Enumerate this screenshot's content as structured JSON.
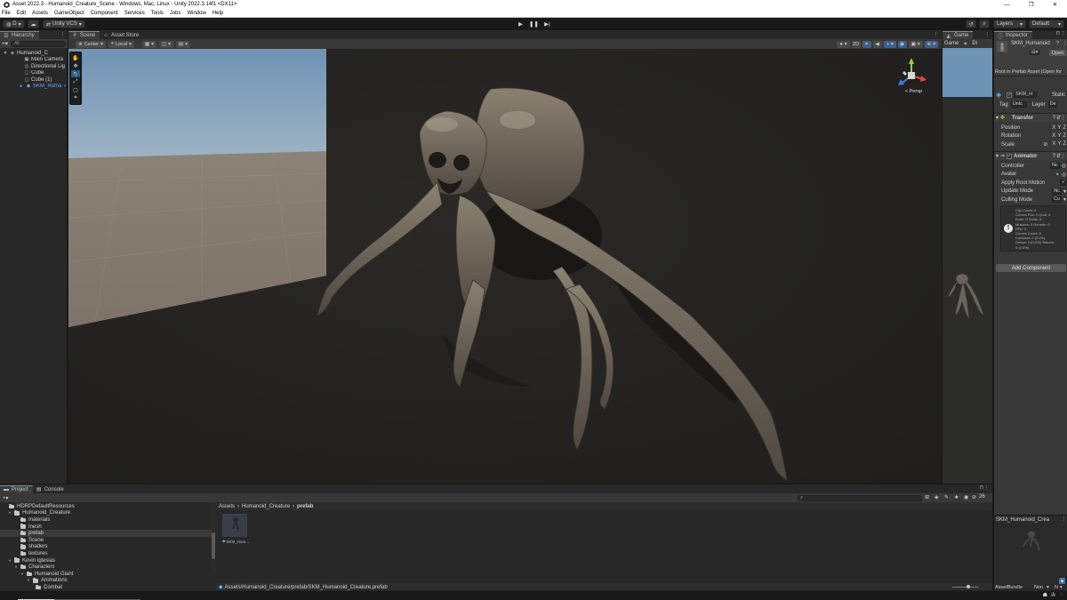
{
  "window": {
    "title": "Asset 2022.3 - Humanoid_Creature_Scene - Windows, Mac, Linux - Unity 2022.3.14f1 <DX11>",
    "controls": [
      "—",
      "❐",
      "✕"
    ]
  },
  "menu": [
    "File",
    "Edit",
    "Assets",
    "GameObject",
    "Component",
    "Services",
    "Tools",
    "Jobs",
    "Window",
    "Help"
  ],
  "toolbar": {
    "account_label": "D",
    "vcs_label": "Unity VCS",
    "layers_label": "Layers",
    "layout_label": "Default"
  },
  "hierarchy": {
    "tab_label": "Hierarchy",
    "search_placeholder": "All",
    "rows": [
      {
        "label": "Humanoid_C",
        "icon": "unity-scene-icon"
      },
      {
        "label": "Main Camera",
        "icon": "camera-icon"
      },
      {
        "label": "Directional Lig",
        "icon": "light-icon"
      },
      {
        "label": "Cube",
        "icon": "cube-icon"
      },
      {
        "label": "Cube (1)",
        "icon": "cube-icon"
      },
      {
        "label": "SKM_Huma",
        "icon": "prefab-icon"
      }
    ]
  },
  "scene": {
    "tabs": [
      "Scene",
      "Asset Store"
    ],
    "pivot_label": "Center",
    "space_label": "Local",
    "mode_2d_label": "2D",
    "persp_label": "< Persp"
  },
  "game": {
    "tab_label": "Game",
    "display_label": "Game",
    "display_short": "Di"
  },
  "inspector": {
    "tab_label": "Inspector",
    "object_name": "SKM_Humanoid",
    "open_label": "Open",
    "prefab_note": "Root in Prefab Asset (Open for",
    "object_field": "SKM_H",
    "static_label": "Static",
    "tag_label": "Tag",
    "tag_value": "Untc",
    "layer_label": "Layer",
    "layer_value": "De",
    "transform": {
      "title": "Transfor",
      "position_label": "Position",
      "rotation_label": "Rotation",
      "scale_label": "Scale",
      "axes": [
        "X",
        "Y",
        "Z"
      ]
    },
    "animator": {
      "title": "Animator",
      "controller_label": "Controller",
      "controller_value": "Nc",
      "avatar_label": "Avatar",
      "apply_root_label": "Apply Root Motion",
      "update_mode_label": "Update Mode",
      "update_mode_value": "Nc",
      "culling_label": "Culling Mode",
      "culling_value": "Cu",
      "info_lines": [
        "Clip Count: 0",
        "Curves Pos: 0 Quat: 0",
        "Euler: 0 Scale: 0",
        "Muscles: 0 Generic: 0",
        "PPtr: 0",
        "Curves Count: 0",
        "Constant: 0 (0.0%)",
        "Dense: 0 (0.0%) Stream:",
        "0 (0.0%)"
      ]
    },
    "add_component_label": "Add Component",
    "preview_title": "SKM_Humanoid_Crea",
    "asset_bundle_label": "AssetBundle",
    "asset_bundle_value": "Non",
    "asset_bundle_variant": "N"
  },
  "project": {
    "tabs": [
      "Project",
      "Console"
    ],
    "tree": [
      {
        "label": "HDRPDefaultResources",
        "depth": 1,
        "fold": ""
      },
      {
        "label": "Humanoid_Creature",
        "depth": 1,
        "fold": "open"
      },
      {
        "label": "materials",
        "depth": 2,
        "fold": ""
      },
      {
        "label": "mesh",
        "depth": 2,
        "fold": ""
      },
      {
        "label": "prefab",
        "depth": 2,
        "fold": "",
        "selected": true
      },
      {
        "label": "Scene",
        "depth": 2,
        "fold": ""
      },
      {
        "label": "shaders",
        "depth": 2,
        "fold": ""
      },
      {
        "label": "textures",
        "depth": 2,
        "fold": ""
      },
      {
        "label": "Kevin Iglesias",
        "depth": 1,
        "fold": "open"
      },
      {
        "label": "Characters",
        "depth": 2,
        "fold": "open"
      },
      {
        "label": "Humanoid Giant",
        "depth": 3,
        "fold": "open"
      },
      {
        "label": "Animations",
        "depth": 4,
        "fold": "open"
      },
      {
        "label": "Combat",
        "depth": 5,
        "fold": ""
      }
    ],
    "breadcrumb": [
      "Assets",
      "Humanoid_Creature",
      "prefab"
    ],
    "asset_label": "SKM_Hum...",
    "path": "Assets/Humanoid_Creature/prefab/SKM_Humanoid_Creature.prefab",
    "visible_count": "26",
    "zoom_level": 0.6
  },
  "status": {
    "progress": 0.3
  }
}
